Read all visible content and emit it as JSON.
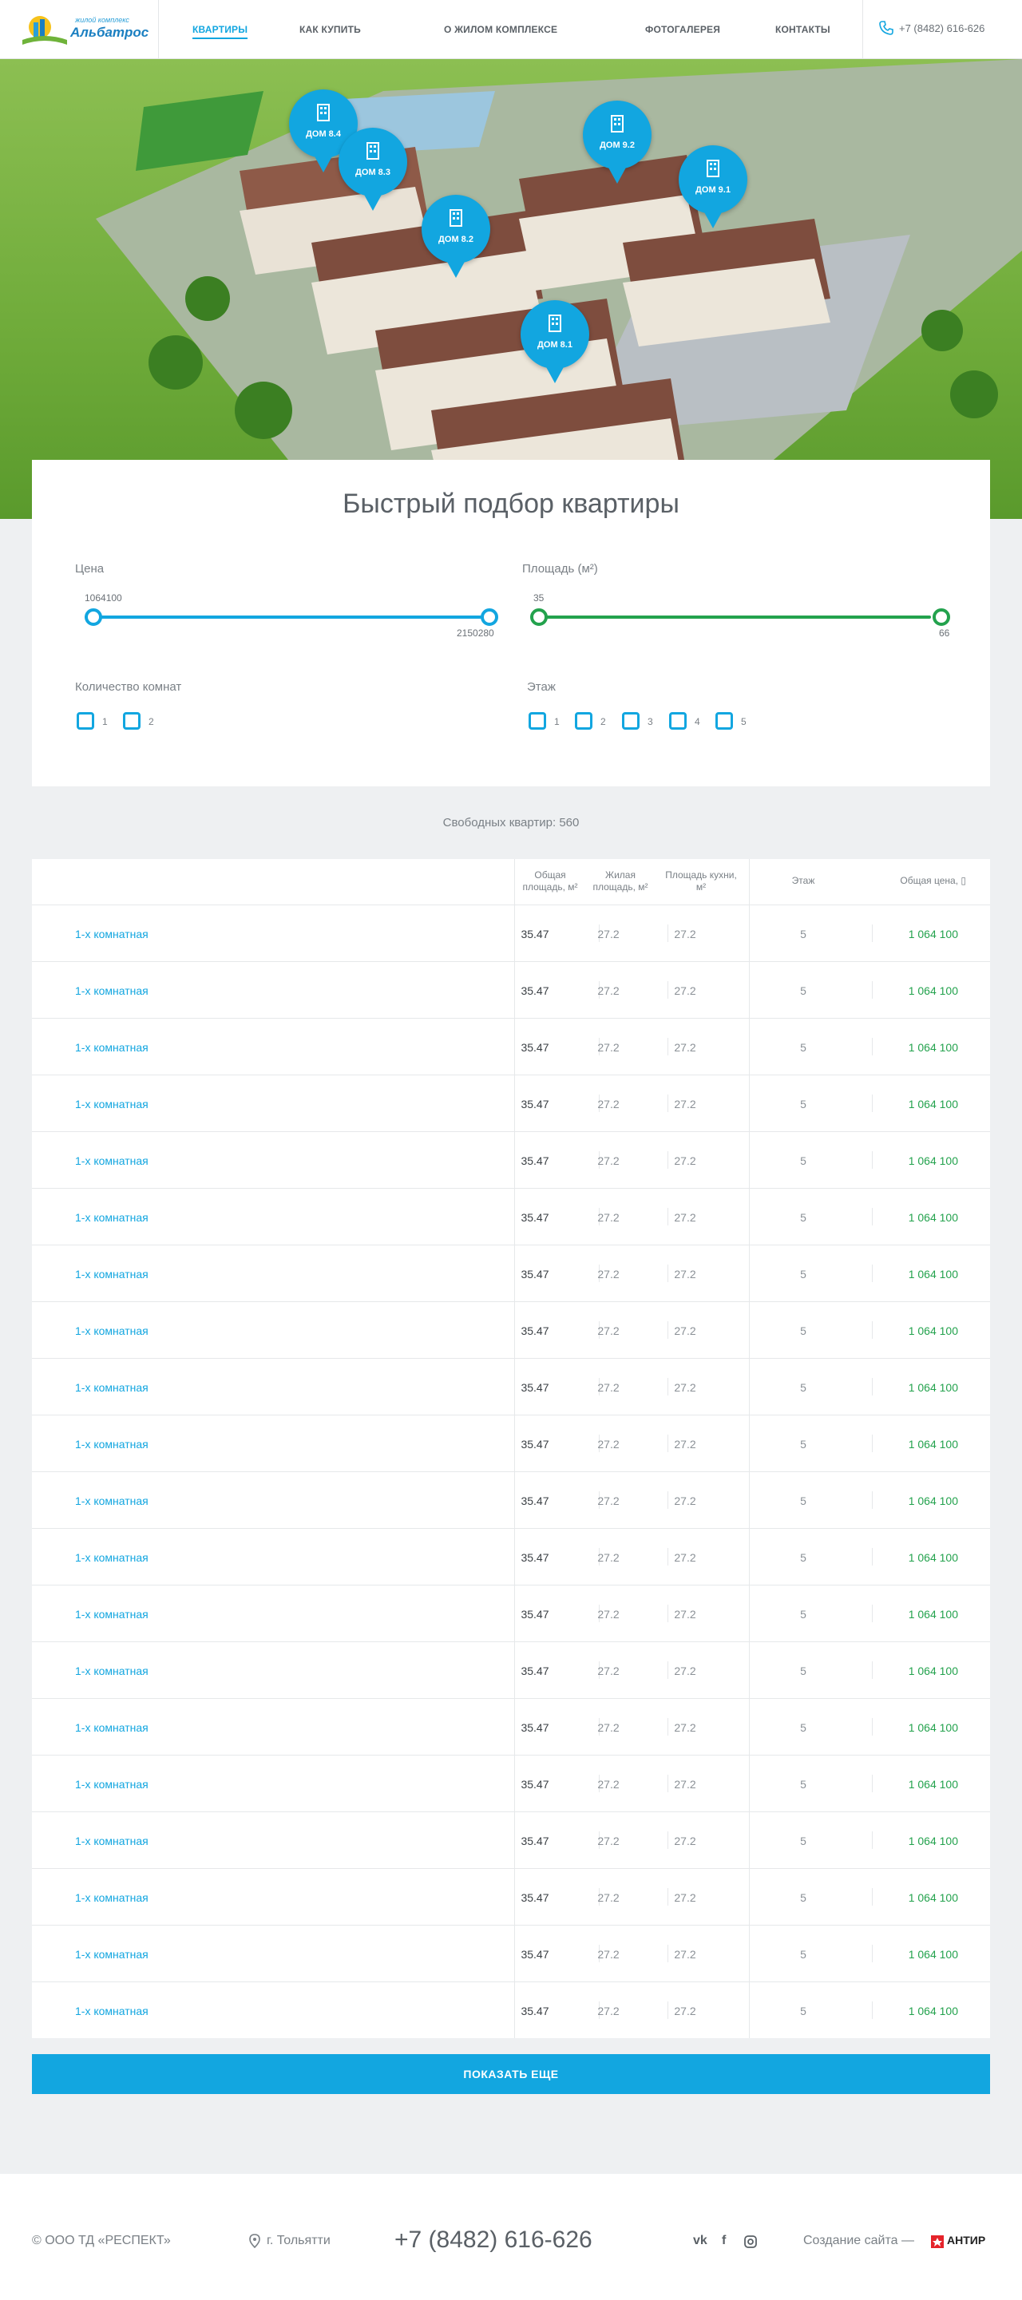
{
  "header": {
    "logo_sub": "жилой комплекс",
    "logo_name": "Альбатрос",
    "nav": [
      {
        "label": "КВАРТИРЫ",
        "active": true
      },
      {
        "label": "КАК КУПИТЬ",
        "active": false
      },
      {
        "label": "О ЖИЛОМ КОМПЛЕКСЕ",
        "active": false
      },
      {
        "label": "ФОТОГАЛЕРЕЯ",
        "active": false
      },
      {
        "label": "КОНТАКТЫ",
        "active": false
      }
    ],
    "phone": "+7 (8482) 616-626",
    "phone_icon": "phone-icon"
  },
  "hero": {
    "pins": [
      "ДОМ 8.4",
      "ДОМ 8.3",
      "ДОМ 8.2",
      "ДОМ 8.1",
      "ДОМ 9.2",
      "ДОМ 9.1"
    ],
    "pin_icon": "building-icon"
  },
  "filter": {
    "title": "Быстрый подбор квартиры",
    "price": {
      "label": "Цена",
      "min": "1064100",
      "max": "2150280"
    },
    "area": {
      "label": "Площадь (м²)",
      "min": "35",
      "max": "66"
    },
    "rooms": {
      "label": "Количество комнат",
      "options": [
        "1",
        "2"
      ]
    },
    "floor": {
      "label": "Этаж",
      "options": [
        "1",
        "2",
        "3",
        "4",
        "5"
      ]
    }
  },
  "free_count": "Свободных квартир: 560",
  "table": {
    "headers": {
      "total": [
        "Общая",
        "площадь, м²"
      ],
      "living": [
        "Жилая",
        "площадь, м²"
      ],
      "kitchen": [
        "Площадь кухни,",
        "м²"
      ],
      "floor": "Этаж",
      "price": "Общая цена, ▯"
    },
    "rows": [
      {
        "name": "1-х комнатная",
        "total": "35.47",
        "living": "27.2",
        "kitchen": "27.2",
        "floor": "5",
        "price": "1 064 100"
      },
      {
        "name": "1-х комнатная",
        "total": "35.47",
        "living": "27.2",
        "kitchen": "27.2",
        "floor": "5",
        "price": "1 064 100"
      },
      {
        "name": "1-х комнатная",
        "total": "35.47",
        "living": "27.2",
        "kitchen": "27.2",
        "floor": "5",
        "price": "1 064 100"
      },
      {
        "name": "1-х комнатная",
        "total": "35.47",
        "living": "27.2",
        "kitchen": "27.2",
        "floor": "5",
        "price": "1 064 100"
      },
      {
        "name": "1-х комнатная",
        "total": "35.47",
        "living": "27.2",
        "kitchen": "27.2",
        "floor": "5",
        "price": "1 064 100"
      },
      {
        "name": "1-х комнатная",
        "total": "35.47",
        "living": "27.2",
        "kitchen": "27.2",
        "floor": "5",
        "price": "1 064 100"
      },
      {
        "name": "1-х комнатная",
        "total": "35.47",
        "living": "27.2",
        "kitchen": "27.2",
        "floor": "5",
        "price": "1 064 100"
      },
      {
        "name": "1-х комнатная",
        "total": "35.47",
        "living": "27.2",
        "kitchen": "27.2",
        "floor": "5",
        "price": "1 064 100"
      },
      {
        "name": "1-х комнатная",
        "total": "35.47",
        "living": "27.2",
        "kitchen": "27.2",
        "floor": "5",
        "price": "1 064 100"
      },
      {
        "name": "1-х комнатная",
        "total": "35.47",
        "living": "27.2",
        "kitchen": "27.2",
        "floor": "5",
        "price": "1 064 100"
      },
      {
        "name": "1-х комнатная",
        "total": "35.47",
        "living": "27.2",
        "kitchen": "27.2",
        "floor": "5",
        "price": "1 064 100"
      },
      {
        "name": "1-х комнатная",
        "total": "35.47",
        "living": "27.2",
        "kitchen": "27.2",
        "floor": "5",
        "price": "1 064 100"
      },
      {
        "name": "1-х комнатная",
        "total": "35.47",
        "living": "27.2",
        "kitchen": "27.2",
        "floor": "5",
        "price": "1 064 100"
      },
      {
        "name": "1-х комнатная",
        "total": "35.47",
        "living": "27.2",
        "kitchen": "27.2",
        "floor": "5",
        "price": "1 064 100"
      },
      {
        "name": "1-х комнатная",
        "total": "35.47",
        "living": "27.2",
        "kitchen": "27.2",
        "floor": "5",
        "price": "1 064 100"
      },
      {
        "name": "1-х комнатная",
        "total": "35.47",
        "living": "27.2",
        "kitchen": "27.2",
        "floor": "5",
        "price": "1 064 100"
      },
      {
        "name": "1-х комнатная",
        "total": "35.47",
        "living": "27.2",
        "kitchen": "27.2",
        "floor": "5",
        "price": "1 064 100"
      },
      {
        "name": "1-х комнатная",
        "total": "35.47",
        "living": "27.2",
        "kitchen": "27.2",
        "floor": "5",
        "price": "1 064 100"
      },
      {
        "name": "1-х комнатная",
        "total": "35.47",
        "living": "27.2",
        "kitchen": "27.2",
        "floor": "5",
        "price": "1 064 100"
      },
      {
        "name": "1-х комнатная",
        "total": "35.47",
        "living": "27.2",
        "kitchen": "27.2",
        "floor": "5",
        "price": "1 064 100"
      }
    ]
  },
  "show_more": "ПОКАЗАТЬ ЕЩЕ",
  "footer": {
    "copyright": "© ООО ТД «РЕСПЕКТ»",
    "city": "г. Тольятти",
    "phone": "+7 (8482) 616-626",
    "social": [
      "vk-icon",
      "facebook-icon",
      "instagram-icon"
    ],
    "made_by": "Создание сайта —",
    "studio": "АНТИР"
  }
}
